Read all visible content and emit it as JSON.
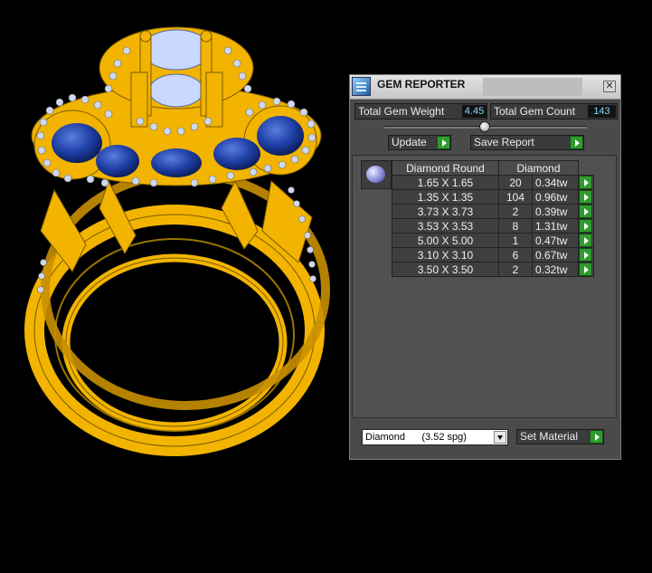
{
  "panel": {
    "title": "GEM REPORTER",
    "close_glyph": "✕",
    "total_weight_label": "Total Gem Weight",
    "total_weight_value": "4.45",
    "total_count_label": "Total Gem Count",
    "total_count_value": "143",
    "update_label": "Update",
    "save_report_label": "Save Report",
    "table": {
      "headers": [
        "Diamond Round",
        "Diamond"
      ],
      "rows": [
        {
          "size": "1.65 X 1.65",
          "count": "20",
          "weight": "0.34tw"
        },
        {
          "size": "1.35 X 1.35",
          "count": "104",
          "weight": "0.96tw"
        },
        {
          "size": "3.73 X 3.73",
          "count": "2",
          "weight": "0.39tw"
        },
        {
          "size": "3.53 X 3.53",
          "count": "8",
          "weight": "1.31tw"
        },
        {
          "size": "5.00 X 5.00",
          "count": "1",
          "weight": "0.47tw"
        },
        {
          "size": "3.10 X 3.10",
          "count": "6",
          "weight": "0.67tw"
        },
        {
          "size": "3.50 X 3.50",
          "count": "2",
          "weight": "0.32tw"
        }
      ]
    },
    "material_select_value": "Diamond      (3.52 spg)",
    "set_material_label": "Set Material"
  },
  "colors": {
    "gold": "#f2b400",
    "sapphire": "#1f3fa6",
    "arrow_green": "#2f9b2f",
    "value_blue": "#86d8ff"
  },
  "icons": {
    "app": "gem-reporter-app-icon",
    "row_action": "green-arrow-icon",
    "gem": "round-diamond-icon"
  }
}
